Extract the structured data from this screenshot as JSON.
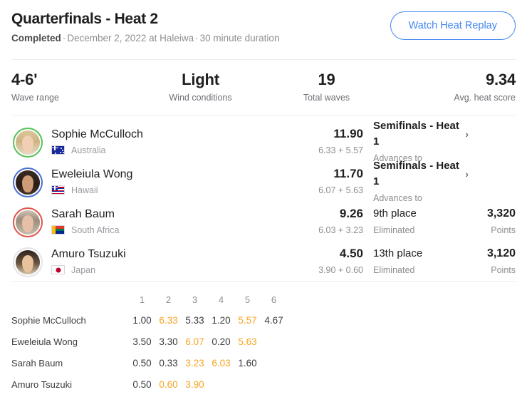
{
  "header": {
    "title": "Quarterfinals - Heat 2",
    "status": "Completed",
    "date": "December 2, 2022 at Haleiwa",
    "duration": "30 minute duration",
    "separator": "·",
    "replay_button": "Watch Heat Replay"
  },
  "stats": [
    {
      "value": "4-6'",
      "label": "Wave range"
    },
    {
      "value": "Light",
      "label": "Wind conditions"
    },
    {
      "value": "19",
      "label": "Total waves"
    },
    {
      "value": "9.34",
      "label": "Avg. heat score"
    }
  ],
  "athletes": [
    {
      "name": "Sophie McCulloch",
      "country": "Australia",
      "flag": "au-flag-icon",
      "total": "11.90",
      "parts": "6.33 + 5.57",
      "status_main": "Semifinals - Heat 1",
      "status_chevron": "›",
      "status_sub": "Advances to",
      "points": "",
      "points_label": "",
      "rank_color": "#56c25a"
    },
    {
      "name": "Eweleiula Wong",
      "country": "Hawaii",
      "flag": "hi-flag-icon",
      "total": "11.70",
      "parts": "6.07 + 5.63",
      "status_main": "Semifinals - Heat 1",
      "status_chevron": "›",
      "status_sub": "Advances to",
      "points": "",
      "points_label": "",
      "rank_color": "#4a6fd4"
    },
    {
      "name": "Sarah Baum",
      "country": "South Africa",
      "flag": "za-flag-icon",
      "total": "9.26",
      "parts": "6.03 + 3.23",
      "status_main": "9th place",
      "status_chevron": "",
      "status_sub": "Eliminated",
      "points": "3,320",
      "points_label": "Points",
      "rank_color": "#e0544b"
    },
    {
      "name": "Amuro Tsuzuki",
      "country": "Japan",
      "flag": "jp-flag-icon",
      "total": "4.50",
      "parts": "3.90 + 0.60",
      "status_main": "13th place",
      "status_chevron": "",
      "status_sub": "Eliminated",
      "points": "3,120",
      "points_label": "Points",
      "rank_color": "#e4e4e8"
    }
  ],
  "wave_table": {
    "wave_numbers": [
      "1",
      "2",
      "3",
      "4",
      "5",
      "6"
    ],
    "rows": [
      {
        "name": "Sophie McCulloch",
        "scores": [
          "1.00",
          "6.33",
          "5.33",
          "1.20",
          "5.57",
          "4.67"
        ],
        "counted": [
          false,
          true,
          false,
          false,
          true,
          false
        ]
      },
      {
        "name": "Eweleiula Wong",
        "scores": [
          "3.50",
          "3.30",
          "6.07",
          "0.20",
          "5.63",
          ""
        ],
        "counted": [
          false,
          false,
          true,
          false,
          true,
          false
        ]
      },
      {
        "name": "Sarah Baum",
        "scores": [
          "0.50",
          "0.33",
          "3.23",
          "6.03",
          "1.60",
          ""
        ],
        "counted": [
          false,
          false,
          true,
          true,
          false,
          false
        ]
      },
      {
        "name": "Amuro Tsuzuki",
        "scores": [
          "0.50",
          "0.60",
          "3.90",
          "",
          "",
          ""
        ],
        "counted": [
          false,
          true,
          true,
          false,
          false,
          false
        ]
      }
    ]
  },
  "colors": {
    "accent_blue": "#4285f4",
    "counted_orange": "#f5a623",
    "rank1": "#56c25a",
    "rank2": "#4a6fd4",
    "rank3": "#e0544b",
    "rank4": "#e4e4e8"
  }
}
